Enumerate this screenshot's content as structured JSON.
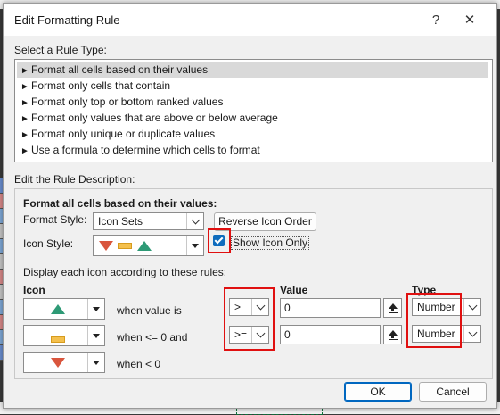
{
  "dialog": {
    "title": "Edit Formatting Rule",
    "help_glyph": "?",
    "close_glyph": "✕"
  },
  "rule_type": {
    "label": "Select a Rule Type:",
    "items": [
      "Format all cells based on their values",
      "Format only cells that contain",
      "Format only top or bottom ranked values",
      "Format only values that are above or below average",
      "Format only unique or duplicate values",
      "Use a formula to determine which cells to format"
    ],
    "selected_index": 0,
    "item_prefix": "►"
  },
  "description": {
    "label": "Edit the Rule Description:",
    "heading": "Format all cells based on their values:",
    "format_style_label": "Format Style:",
    "format_style_value": "Icon Sets",
    "reverse_button": "Reverse Icon Order",
    "icon_style_label": "Icon Style:",
    "show_icon_only_label": "Show Icon Only",
    "show_icon_only_checked": true,
    "rules_caption": "Display each icon according to these rules:",
    "col_icon": "Icon",
    "col_value": "Value",
    "col_type": "Type",
    "rules": [
      {
        "icon": "green-up-triangle-icon",
        "text": "when value is",
        "operator": ">",
        "value": "0",
        "type": "Number"
      },
      {
        "icon": "yellow-dash-icon",
        "text": "when <= 0 and",
        "operator": ">=",
        "value": "0",
        "type": "Number"
      },
      {
        "icon": "red-down-triangle-icon",
        "text": "when < 0"
      }
    ]
  },
  "buttons": {
    "ok": "OK",
    "cancel": "Cancel"
  },
  "colors": {
    "accent": "#0067c0",
    "highlight_box": "#e01010",
    "icon_green": "#2e9a76",
    "icon_yellow": "#f4c04d",
    "icon_red": "#d9553d"
  }
}
